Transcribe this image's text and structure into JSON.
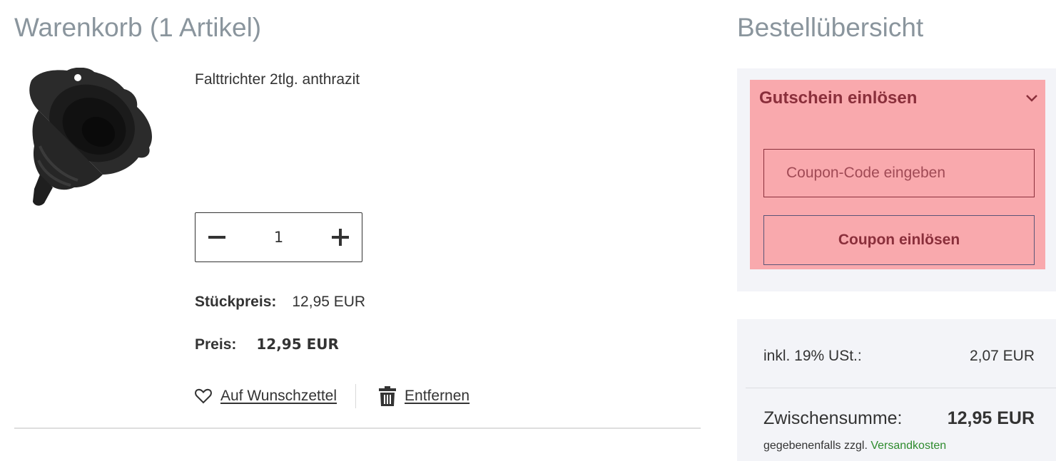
{
  "cart": {
    "title": "Warenkorb (1 Artikel)",
    "product": {
      "name": "Falttrichter 2tlg. anthrazit",
      "quantity": "1",
      "unit_price_label": "Stückpreis:",
      "unit_price": "12,95 EUR",
      "price_label": "Preis:",
      "price": "12,95 EUR"
    },
    "actions": {
      "wishlist_label": "Auf Wunschzettel",
      "remove_label": "Entfernen"
    }
  },
  "summary": {
    "title": "Bestellübersicht",
    "coupon": {
      "title": "Gutschein einlösen",
      "input_placeholder": "Coupon-Code eingeben",
      "input_value": "",
      "button_label": "Coupon einlösen"
    },
    "totals": {
      "tax_label": "inkl. 19% USt.:",
      "tax_value": "2,07 EUR",
      "subtotal_label": "Zwischensumme:",
      "subtotal_value": "12,95 EUR",
      "shipping_note": "gegebenenfalls zzgl.",
      "shipping_link": "Versandkosten"
    }
  },
  "colors": {
    "coupon_highlight": "#f9a9ad",
    "coupon_text": "#8a2f3b",
    "panel_bg": "#f3f4f8",
    "title_grey": "#8a959d",
    "link_green": "#2e8b2e"
  },
  "icons": [
    "product-image-funnel",
    "minus-icon",
    "plus-icon",
    "chevron-down-icon",
    "heart-icon",
    "trash-icon"
  ]
}
